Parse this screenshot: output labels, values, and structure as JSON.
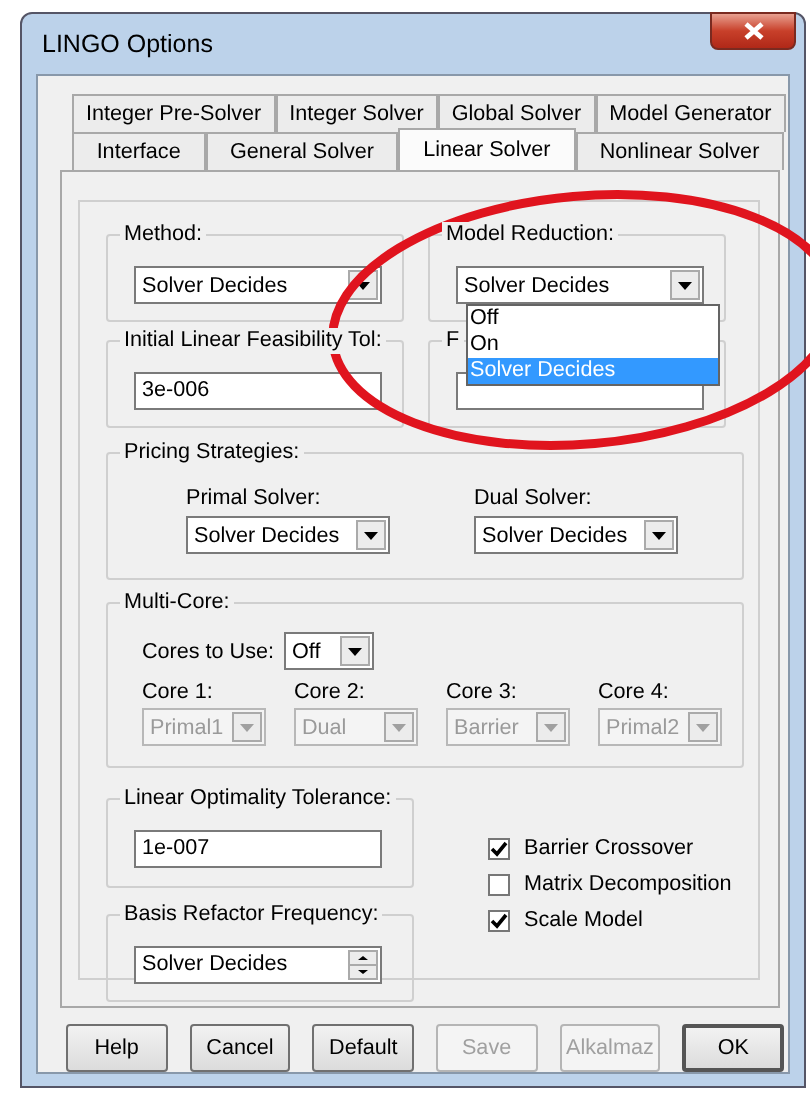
{
  "window": {
    "title": "LINGO Options"
  },
  "tab_rows": [
    {
      "tabs": [
        {
          "label": "Integer Pre-Solver",
          "selected": false
        },
        {
          "label": "Integer Solver",
          "selected": false
        },
        {
          "label": "Global Solver",
          "selected": false
        },
        {
          "label": "Model Generator",
          "selected": false
        }
      ]
    },
    {
      "tabs": [
        {
          "label": "Interface",
          "selected": false
        },
        {
          "label": "General Solver",
          "selected": false
        },
        {
          "label": "Linear Solver",
          "selected": true
        },
        {
          "label": "Nonlinear Solver",
          "selected": false
        }
      ]
    }
  ],
  "method": {
    "label": "Method:",
    "value": "Solver Decides"
  },
  "model_reduction": {
    "label": "Model Reduction:",
    "value": "Solver Decides",
    "expanded": true,
    "options": [
      {
        "label": "Off",
        "selected": false
      },
      {
        "label": "On",
        "selected": false
      },
      {
        "label": "Solver Decides",
        "selected": true
      }
    ]
  },
  "initial_feasibility_tol": {
    "label": "Initial Linear Feasibility Tol:",
    "value": "3e-006"
  },
  "group_4": {
    "label": "F"
  },
  "pricing_strategies": {
    "label": "Pricing Strategies:",
    "primal_solver": {
      "label": "Primal Solver:",
      "value": "Solver Decides"
    },
    "dual_solver": {
      "label": "Dual Solver:",
      "value": "Solver Decides"
    }
  },
  "multi_core": {
    "label": "Multi-Core:",
    "cores_to_use": {
      "label": "Cores to Use:",
      "value": "Off"
    },
    "cores": [
      {
        "label": "Core 1:",
        "value": "Primal1",
        "disabled": true
      },
      {
        "label": "Core 2:",
        "value": "Dual",
        "disabled": true
      },
      {
        "label": "Core 3:",
        "value": "Barrier",
        "disabled": true
      },
      {
        "label": "Core 4:",
        "value": "Primal2",
        "disabled": true
      }
    ]
  },
  "linear_optimality_tolerance": {
    "label": "Linear Optimality Tolerance:",
    "value": "1e-007"
  },
  "basis_refactor_frequency": {
    "label": "Basis Refactor Frequency:",
    "value": "Solver Decides"
  },
  "checkboxes": [
    {
      "label": "Barrier Crossover",
      "checked": true
    },
    {
      "label": "Matrix Decomposition",
      "checked": false
    },
    {
      "label": "Scale Model",
      "checked": true
    }
  ],
  "buttons": [
    {
      "label": "Help",
      "disabled": false
    },
    {
      "label": "Cancel",
      "disabled": false
    },
    {
      "label": "Default",
      "disabled": false
    },
    {
      "label": "Save",
      "disabled": true
    },
    {
      "label": "Alkalmaz",
      "disabled": true
    },
    {
      "label": "OK",
      "disabled": false
    }
  ],
  "annotation": {
    "kind": "ellipse"
  }
}
